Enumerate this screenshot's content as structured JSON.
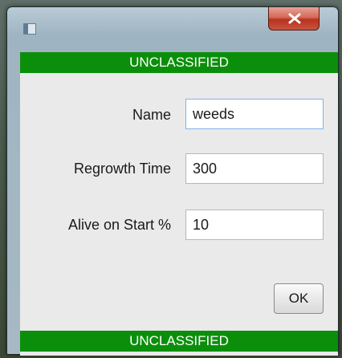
{
  "window": {
    "icon": "app-window-icon",
    "close_icon": "close-x-icon"
  },
  "classification": {
    "top": "UNCLASSIFIED",
    "bottom": "UNCLASSIFIED",
    "color": "#0b8f0b"
  },
  "form": {
    "name": {
      "label": "Name",
      "value": "weeds"
    },
    "regrowth": {
      "label": "Regrowth Time",
      "value": "300"
    },
    "alive": {
      "label": "Alive on Start %",
      "value": "10"
    }
  },
  "actions": {
    "ok_label": "OK"
  }
}
